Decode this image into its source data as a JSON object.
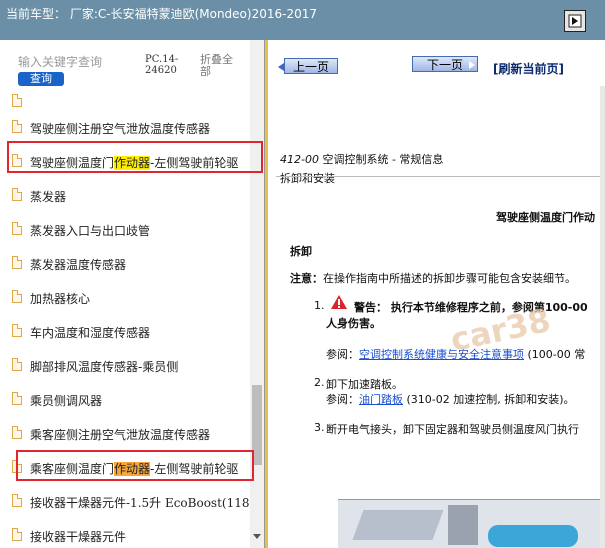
{
  "window": {
    "title": "当前车型： 厂家:C-长安福特蒙迪欧(Mondeo)2016-2017"
  },
  "left_panel": {
    "search": {
      "placeholder": "输入关键字查询",
      "button_label": "查询"
    },
    "doc_code": "PC.14-24620",
    "collapse_all_label": "折叠全部",
    "tree_items": [
      {
        "label": ""
      },
      {
        "label": "驾驶座侧注册空气泄放温度传感器"
      },
      {
        "label_parts": [
          "驾驶座侧温度门",
          "作动器",
          "-左侧驾驶前轮驱"
        ]
      },
      {
        "label": "蒸发器"
      },
      {
        "label": "蒸发器入口与出口歧管"
      },
      {
        "label": "蒸发器温度传感器"
      },
      {
        "label": "加热器核心"
      },
      {
        "label": "车内温度和湿度传感器"
      },
      {
        "label": "脚部排风温度传感器-乘员侧"
      },
      {
        "label": "乘员侧调风器"
      },
      {
        "label": "乘客座侧注册空气泄放温度传感器"
      },
      {
        "label_parts": [
          "乘客座侧温度门",
          "作动器",
          "-左侧驾驶前轮驱"
        ]
      },
      {
        "label": "接收器干燥器元件-1.5升 EcoBoost(118"
      },
      {
        "label": "接收器干燥器元件"
      }
    ]
  },
  "right_panel": {
    "nav": {
      "prev_label": "上一页",
      "next_label": "下一页",
      "refresh_label": "[刷新当前页]"
    },
    "doc": {
      "section_code": "412-00",
      "section_name": "空调控制系统 - 常规信息",
      "subtitle": "拆卸和安装",
      "heading": "驾驶座侧温度门作动",
      "removal_label": "拆卸",
      "note_label": "注意：",
      "note_text": "在操作指南中所描述的拆卸步骤可能包含安装细节。",
      "step1_num": "1.",
      "step1_warning_label": "警告：",
      "step1_warning_text": "执行本节维修程序之前，参阅第100-00",
      "step1_warning_text2": "人身伤害。",
      "step1_ref_label": "参阅：",
      "step1_ref_link": "空调控制系统健康与安全注意事项",
      "step1_ref_suffix": "(100-00 常",
      "step2_num": "2.",
      "step2_text": "卸下加速踏板。",
      "step2_ref_label": "参阅：",
      "step2_ref_link": "油门踏板",
      "step2_ref_suffix": "(310-02 加速控制, 拆卸和安装)。",
      "step3_num": "3.",
      "step3_text": "断开电气接头，卸下固定器和驾驶员侧温度风门执行",
      "watermark": "car38"
    }
  },
  "colors": {
    "top_bar": "#6b8fa6",
    "highlight_yellow": "#ffee00",
    "highlight_orange": "#f6a63a",
    "annotation_red": "#e2262f",
    "link_blue": "#1a4fd0"
  }
}
